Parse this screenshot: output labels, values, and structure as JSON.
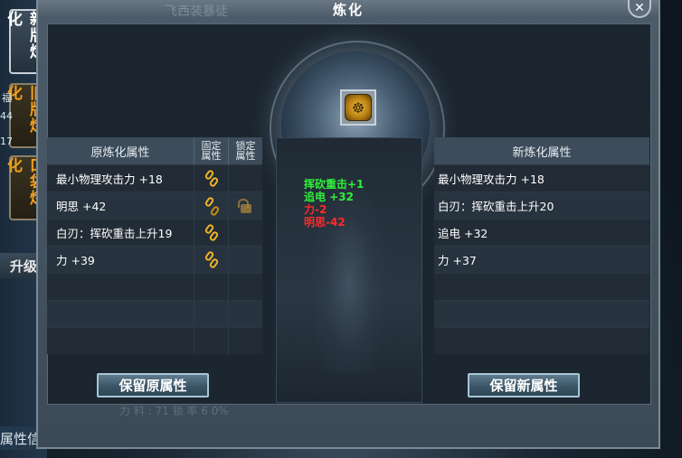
{
  "window": {
    "title": "炼化",
    "background_name": "飞西装暴徒",
    "close_glyph": "✕"
  },
  "side_tabs": [
    {
      "label": "新版炼化",
      "active": true
    },
    {
      "label": "旧版炼化",
      "active": false
    },
    {
      "label": "口袋炼化",
      "active": false
    }
  ],
  "left_fragments": {
    "a": "福",
    "b": "44",
    "c": "17",
    "upgrade": "升级",
    "attr_info": "属性信息"
  },
  "left_table": {
    "header_main": "原炼化属性",
    "header_fixed": [
      "固定",
      "属性"
    ],
    "header_lock": [
      "锁定",
      "属性"
    ],
    "rows": [
      {
        "text": "最小物理攻击力 +18",
        "fixed": "chain",
        "lock": ""
      },
      {
        "text": "明思 +42",
        "fixed": "chain-broken",
        "lock": "unlocked"
      },
      {
        "text": "白刃：挥砍重击上升19",
        "fixed": "chain",
        "lock": ""
      },
      {
        "text": "力 +39",
        "fixed": "chain",
        "lock": ""
      },
      {
        "text": "",
        "fixed": "",
        "lock": ""
      },
      {
        "text": "",
        "fixed": "",
        "lock": ""
      },
      {
        "text": "",
        "fixed": "",
        "lock": ""
      }
    ]
  },
  "changes": [
    {
      "text": "挥砍重击+1",
      "dir": "up"
    },
    {
      "text": "追电 +32",
      "dir": "up"
    },
    {
      "text": "力-2",
      "dir": "down"
    },
    {
      "text": "明思-42",
      "dir": "down"
    }
  ],
  "right_table": {
    "header": "新炼化属性",
    "rows": [
      "最小物理攻击力 +18",
      "白刃：挥砍重击上升20",
      "追电 +32",
      "力 +37",
      "",
      "",
      ""
    ]
  },
  "buttons": {
    "keep_old": "保留原属性",
    "keep_new": "保留新属性"
  },
  "bottom_faded": "力 料 : 71        锁 率 6 0%"
}
